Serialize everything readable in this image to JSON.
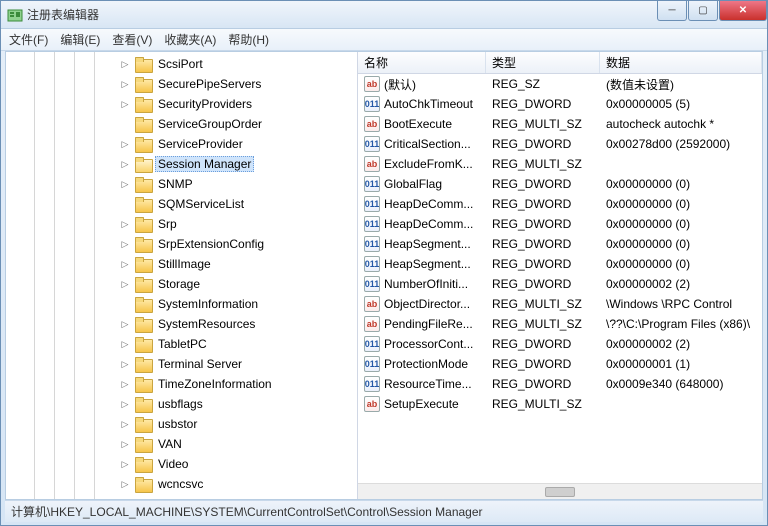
{
  "window": {
    "title": "注册表编辑器"
  },
  "menu": {
    "file": "文件(F)",
    "edit": "编辑(E)",
    "view": "查看(V)",
    "fav": "收藏夹(A)",
    "help": "帮助(H)"
  },
  "tree": {
    "items": [
      {
        "label": "ScsiPort",
        "expandable": true,
        "selected": false
      },
      {
        "label": "SecurePipeServers",
        "expandable": true,
        "selected": false
      },
      {
        "label": "SecurityProviders",
        "expandable": true,
        "selected": false
      },
      {
        "label": "ServiceGroupOrder",
        "expandable": false,
        "selected": false
      },
      {
        "label": "ServiceProvider",
        "expandable": true,
        "selected": false
      },
      {
        "label": "Session Manager",
        "expandable": true,
        "selected": true
      },
      {
        "label": "SNMP",
        "expandable": true,
        "selected": false
      },
      {
        "label": "SQMServiceList",
        "expandable": false,
        "selected": false
      },
      {
        "label": "Srp",
        "expandable": true,
        "selected": false
      },
      {
        "label": "SrpExtensionConfig",
        "expandable": true,
        "selected": false
      },
      {
        "label": "StillImage",
        "expandable": true,
        "selected": false
      },
      {
        "label": "Storage",
        "expandable": true,
        "selected": false
      },
      {
        "label": "SystemInformation",
        "expandable": false,
        "selected": false
      },
      {
        "label": "SystemResources",
        "expandable": true,
        "selected": false
      },
      {
        "label": "TabletPC",
        "expandable": true,
        "selected": false
      },
      {
        "label": "Terminal Server",
        "expandable": true,
        "selected": false
      },
      {
        "label": "TimeZoneInformation",
        "expandable": true,
        "selected": false
      },
      {
        "label": "usbflags",
        "expandable": true,
        "selected": false
      },
      {
        "label": "usbstor",
        "expandable": true,
        "selected": false
      },
      {
        "label": "VAN",
        "expandable": true,
        "selected": false
      },
      {
        "label": "Video",
        "expandable": true,
        "selected": false
      },
      {
        "label": "wcncsvc",
        "expandable": true,
        "selected": false
      }
    ]
  },
  "list": {
    "headers": {
      "name": "名称",
      "type": "类型",
      "data": "数据"
    },
    "rows": [
      {
        "icon": "sz",
        "name": "(默认)",
        "type": "REG_SZ",
        "data": "(数值未设置)"
      },
      {
        "icon": "bin",
        "name": "AutoChkTimeout",
        "type": "REG_DWORD",
        "data": "0x00000005 (5)"
      },
      {
        "icon": "sz",
        "name": "BootExecute",
        "type": "REG_MULTI_SZ",
        "data": "autocheck autochk *"
      },
      {
        "icon": "bin",
        "name": "CriticalSection...",
        "type": "REG_DWORD",
        "data": "0x00278d00 (2592000)"
      },
      {
        "icon": "sz",
        "name": "ExcludeFromK...",
        "type": "REG_MULTI_SZ",
        "data": ""
      },
      {
        "icon": "bin",
        "name": "GlobalFlag",
        "type": "REG_DWORD",
        "data": "0x00000000 (0)"
      },
      {
        "icon": "bin",
        "name": "HeapDeComm...",
        "type": "REG_DWORD",
        "data": "0x00000000 (0)"
      },
      {
        "icon": "bin",
        "name": "HeapDeComm...",
        "type": "REG_DWORD",
        "data": "0x00000000 (0)"
      },
      {
        "icon": "bin",
        "name": "HeapSegment...",
        "type": "REG_DWORD",
        "data": "0x00000000 (0)"
      },
      {
        "icon": "bin",
        "name": "HeapSegment...",
        "type": "REG_DWORD",
        "data": "0x00000000 (0)"
      },
      {
        "icon": "bin",
        "name": "NumberOfIniti...",
        "type": "REG_DWORD",
        "data": "0x00000002 (2)"
      },
      {
        "icon": "sz",
        "name": "ObjectDirector...",
        "type": "REG_MULTI_SZ",
        "data": "\\Windows \\RPC Control"
      },
      {
        "icon": "sz",
        "name": "PendingFileRe...",
        "type": "REG_MULTI_SZ",
        "data": "\\??\\C:\\Program Files (x86)\\"
      },
      {
        "icon": "bin",
        "name": "ProcessorCont...",
        "type": "REG_DWORD",
        "data": "0x00000002 (2)"
      },
      {
        "icon": "bin",
        "name": "ProtectionMode",
        "type": "REG_DWORD",
        "data": "0x00000001 (1)"
      },
      {
        "icon": "bin",
        "name": "ResourceTime...",
        "type": "REG_DWORD",
        "data": "0x0009e340 (648000)"
      },
      {
        "icon": "sz",
        "name": "SetupExecute",
        "type": "REG_MULTI_SZ",
        "data": ""
      }
    ]
  },
  "status": {
    "path": "计算机\\HKEY_LOCAL_MACHINE\\SYSTEM\\CurrentControlSet\\Control\\Session Manager"
  },
  "icons": {
    "sz_text": "ab",
    "bin_text": "011"
  }
}
